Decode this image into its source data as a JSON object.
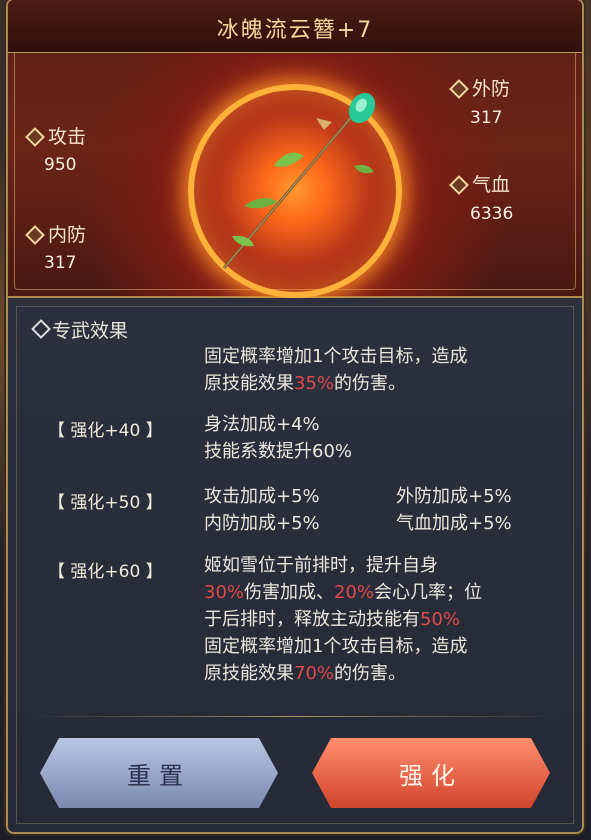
{
  "item": {
    "name": "冰魄流云簪+7"
  },
  "stats": {
    "attack": {
      "label": "攻击",
      "value": "950"
    },
    "inner_defense": {
      "label": "内防",
      "value": "317"
    },
    "outer_defense": {
      "label": "外防",
      "value": "317"
    },
    "hp": {
      "label": "气血",
      "value": "6336"
    }
  },
  "effect": {
    "heading": "专武效果",
    "base": {
      "line1": "固定概率增加1个攻击目标，造成",
      "line2_prefix": "原技能效果",
      "line2_pct": "35%",
      "line2_suffix": "的伤害。"
    },
    "tiers": [
      {
        "label": "【 强化+40 】",
        "lines": [
          "身法加成+4%",
          "技能系数提升60%"
        ]
      },
      {
        "label": "【 强化+50 】",
        "col1": [
          "攻击加成+5%",
          "内防加成+5%"
        ],
        "col2": [
          "外防加成+5%",
          "气血加成+5%"
        ]
      },
      {
        "label": "【 强化+60 】",
        "l1": "姬如雪位于前排时，提升自身",
        "l2a": "30%",
        "l2b": "伤害加成、",
        "l2c": "20%",
        "l2d": "会心几率；位",
        "l3a": "于后排时，释放主动技能有",
        "l3b": "50%",
        "l4": "固定概率增加1个攻击目标，造成",
        "l5a": "原技能效果",
        "l5b": "70%",
        "l5c": "的伤害。"
      }
    ]
  },
  "buttons": {
    "reset": "重置",
    "enhance": "强化"
  },
  "colors": {
    "highlight_red": "#e04a4a",
    "title_gold": "#f3d89a"
  }
}
